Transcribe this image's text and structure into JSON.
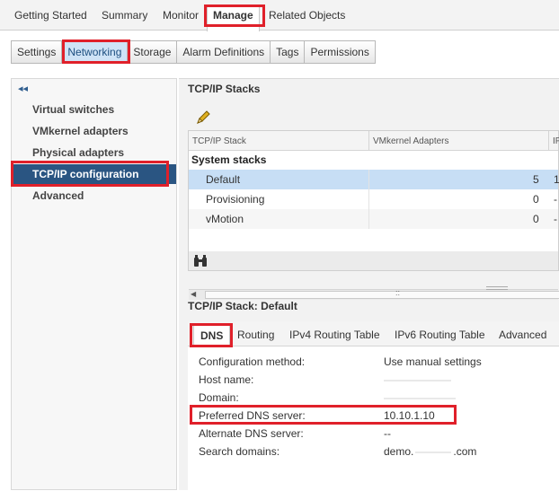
{
  "top_tabs": [
    {
      "label": "Getting Started"
    },
    {
      "label": "Summary"
    },
    {
      "label": "Monitor"
    },
    {
      "label": "Manage"
    },
    {
      "label": "Related Objects"
    }
  ],
  "sub_tabs": [
    {
      "label": "Settings"
    },
    {
      "label": "Networking"
    },
    {
      "label": "Storage"
    },
    {
      "label": "Alarm Definitions"
    },
    {
      "label": "Tags"
    },
    {
      "label": "Permissions"
    }
  ],
  "left_nav": {
    "collapse_icon": "double-chevron-left-icon",
    "items": [
      {
        "label": "Virtual switches"
      },
      {
        "label": "VMkernel adapters"
      },
      {
        "label": "Physical adapters"
      },
      {
        "label": "TCP/IP configuration"
      },
      {
        "label": "Advanced"
      }
    ]
  },
  "stacks": {
    "title": "TCP/IP Stacks",
    "edit_icon": "pencil-icon",
    "columns": [
      "TCP/IP Stack",
      "VMkernel Adapters",
      "IP"
    ],
    "group_label": "System stacks",
    "rows": [
      {
        "name": "Default",
        "count": "5",
        "ip": "1"
      },
      {
        "name": "Provisioning",
        "count": "0",
        "ip": "-"
      },
      {
        "name": "vMotion",
        "count": "0",
        "ip": "-"
      }
    ],
    "scroll_grip": "::",
    "filter_icon": "binoculars-icon"
  },
  "detail": {
    "title": "TCP/IP Stack: Default",
    "tabs": [
      {
        "label": "DNS"
      },
      {
        "label": "Routing"
      },
      {
        "label": "IPv4 Routing Table"
      },
      {
        "label": "IPv6 Routing Table"
      },
      {
        "label": "Advanced"
      }
    ],
    "properties": [
      {
        "label": "Configuration method:",
        "value": "Use manual settings"
      },
      {
        "label": "Host name:",
        "value": ""
      },
      {
        "label": "Domain:",
        "value": ""
      },
      {
        "label": "Preferred DNS server:",
        "value": "10.10.1.10"
      },
      {
        "label": "Alternate DNS server:",
        "value": "--"
      },
      {
        "label": "Search domains:",
        "value": "demo.",
        "value_suffix": ".com"
      }
    ]
  },
  "colors": {
    "accent": "#2a5582",
    "selected_row": "#c7def5",
    "highlight_annotation": "#e0202a"
  }
}
